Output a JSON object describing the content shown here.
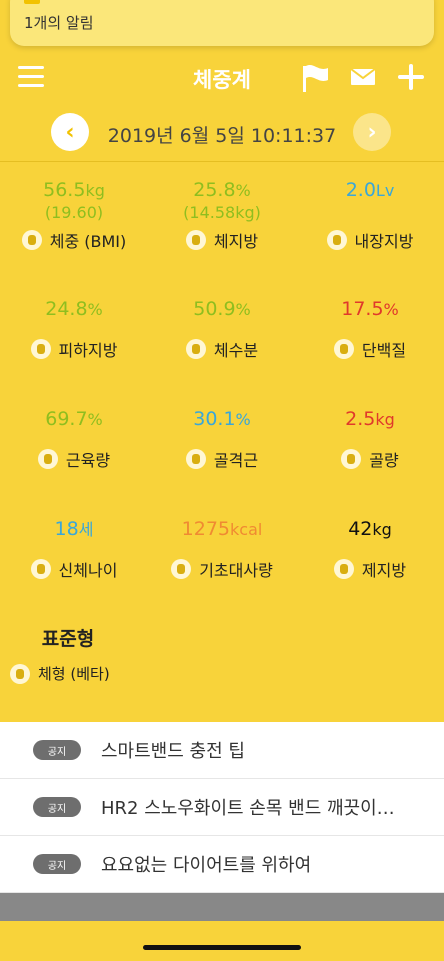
{
  "notification": {
    "text": "1개의 알림"
  },
  "header": {
    "title": "체중계"
  },
  "date": {
    "text": "2019년 6월 5일 10:11:37",
    "prev": "‹",
    "next": "›"
  },
  "metrics": [
    {
      "value": "56.5",
      "unit": "kg",
      "sub": "(19.60)",
      "label": "체중 (BMI)",
      "color": "#8fbe1f",
      "icon": "scale-icon"
    },
    {
      "value": "25.8",
      "unit": "%",
      "sub": "(14.58kg)",
      "label": "체지방",
      "color": "#8fbe1f",
      "icon": "body-fat-icon"
    },
    {
      "value": "2.0",
      "unit": "Lv",
      "sub": "",
      "label": "내장지방",
      "color": "#3aa7d8",
      "icon": "visceral-fat-icon"
    },
    {
      "value": "24.8",
      "unit": "%",
      "sub": "",
      "label": "피하지방",
      "color": "#8fbe1f",
      "icon": "subcutaneous-fat-icon"
    },
    {
      "value": "50.9",
      "unit": "%",
      "sub": "",
      "label": "체수분",
      "color": "#8fbe1f",
      "icon": "water-drop-icon"
    },
    {
      "value": "17.5",
      "unit": "%",
      "sub": "",
      "label": "단백질",
      "color": "#e0392b",
      "icon": "protein-icon"
    },
    {
      "value": "69.7",
      "unit": "%",
      "sub": "",
      "label": "근육량",
      "color": "#8fbe1f",
      "icon": "muscle-icon"
    },
    {
      "value": "30.1",
      "unit": "%",
      "sub": "",
      "label": "골격근",
      "color": "#3aa7d8",
      "icon": "skeletal-muscle-icon"
    },
    {
      "value": "2.5",
      "unit": "kg",
      "sub": "",
      "label": "골량",
      "color": "#e0392b",
      "icon": "bone-icon"
    },
    {
      "value": "18",
      "unit": "세",
      "sub": "",
      "label": "신체나이",
      "color": "#3aa7d8",
      "icon": "body-age-icon"
    },
    {
      "value": "1275",
      "unit": "kcal",
      "sub": "",
      "label": "기초대사량",
      "color": "#f08a32",
      "icon": "flame-icon"
    },
    {
      "value": "42",
      "unit": "kg",
      "sub": "",
      "label": "제지방",
      "color": "#111111",
      "icon": "fat-free-icon"
    }
  ],
  "bodytype": {
    "title": "표준형",
    "label": "체형 (베타)"
  },
  "notices": [
    {
      "badge": "공지",
      "text": "스마트밴드 충전 팁"
    },
    {
      "badge": "공지",
      "text": "HR2 스노우화이트 손목 밴드 깨끗이…"
    },
    {
      "badge": "공지",
      "text": "요요없는 다이어트를 위하여"
    }
  ]
}
